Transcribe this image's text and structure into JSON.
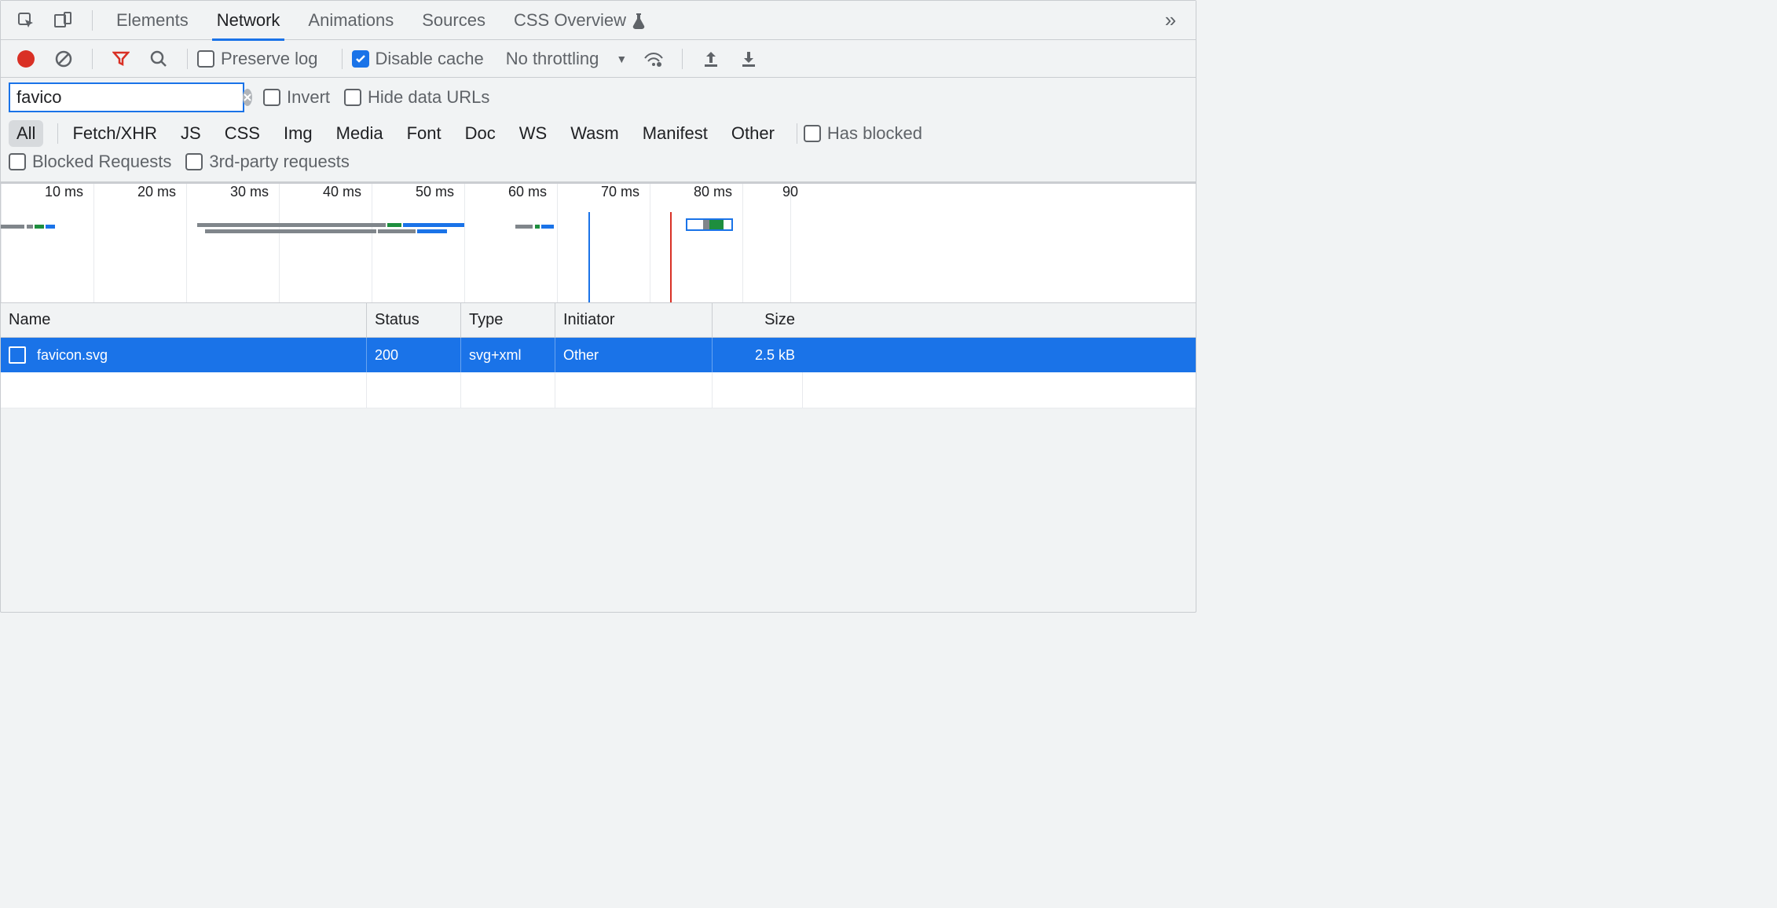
{
  "tabs": {
    "elements": "Elements",
    "network": "Network",
    "animations": "Animations",
    "sources": "Sources",
    "css_overview": "CSS Overview"
  },
  "toolbar": {
    "preserve_log": "Preserve log",
    "disable_cache": "Disable cache",
    "throttling": "No throttling"
  },
  "filter": {
    "value": "favico",
    "invert": "Invert",
    "hide_data_urls": "Hide data URLs",
    "has_blocked": "Has blocked",
    "blocked_requests": "Blocked Requests",
    "third_party": "3rd-party requests"
  },
  "types": {
    "all": "All",
    "fetch_xhr": "Fetch/XHR",
    "js": "JS",
    "css": "CSS",
    "img": "Img",
    "media": "Media",
    "font": "Font",
    "doc": "Doc",
    "ws": "WS",
    "wasm": "Wasm",
    "manifest": "Manifest",
    "other": "Other"
  },
  "waterfall": {
    "ticks": [
      "10 ms",
      "20 ms",
      "30 ms",
      "40 ms",
      "50 ms",
      "60 ms",
      "70 ms",
      "80 ms",
      "90 "
    ]
  },
  "columns": {
    "name": "Name",
    "status": "Status",
    "type": "Type",
    "initiator": "Initiator",
    "size": "Size"
  },
  "rows": [
    {
      "name": "favicon.svg",
      "status": "200",
      "type": "svg+xml",
      "initiator": "Other",
      "size": "2.5 kB"
    }
  ]
}
